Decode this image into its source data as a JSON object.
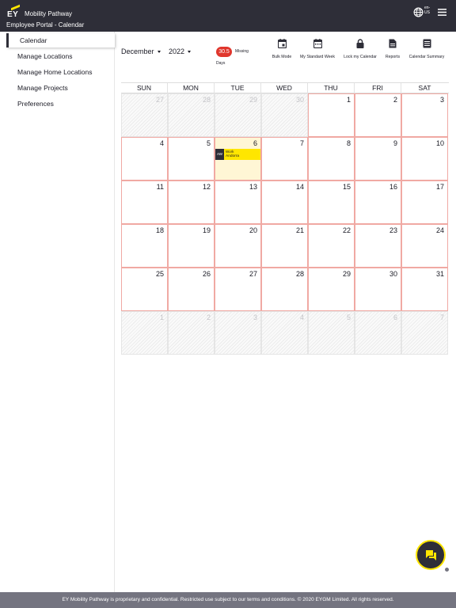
{
  "header": {
    "logo_text": "EY",
    "app_title": "Mobility Pathway",
    "subtitle": "Employee Portal - Calendar",
    "language": "en-US"
  },
  "sidebar": {
    "items": [
      {
        "label": "Calendar",
        "active": true
      },
      {
        "label": "Manage Locations"
      },
      {
        "label": "Manage Home Locations"
      },
      {
        "label": "Manage Projects"
      },
      {
        "label": "Preferences"
      }
    ]
  },
  "toolbar": {
    "month": "December",
    "year": "2022",
    "missing_count": "30.5",
    "missing_label": "Missing",
    "missing_days_label": "Days",
    "tools": [
      {
        "label": "Bulk Mode",
        "icon": "calendar-event-icon"
      },
      {
        "label": "My Standard Week",
        "icon": "calendar-week-icon"
      },
      {
        "label": "Lock my Calendar",
        "icon": "lock-icon"
      },
      {
        "label": "Reports",
        "icon": "document-icon"
      },
      {
        "label": "Calendar Summary",
        "icon": "list-icon"
      }
    ]
  },
  "calendar": {
    "weekdays": [
      "SUN",
      "MON",
      "TUE",
      "WED",
      "THU",
      "FRI",
      "SAT"
    ],
    "weeks": [
      [
        {
          "d": "27",
          "o": true
        },
        {
          "d": "28",
          "o": true
        },
        {
          "d": "29",
          "o": true
        },
        {
          "d": "30",
          "o": true
        },
        {
          "d": "1"
        },
        {
          "d": "2"
        },
        {
          "d": "3"
        }
      ],
      [
        {
          "d": "4"
        },
        {
          "d": "5"
        },
        {
          "d": "6",
          "today": true
        },
        {
          "d": "7"
        },
        {
          "d": "8"
        },
        {
          "d": "9"
        },
        {
          "d": "10"
        }
      ],
      [
        {
          "d": "11"
        },
        {
          "d": "12"
        },
        {
          "d": "13"
        },
        {
          "d": "14"
        },
        {
          "d": "15"
        },
        {
          "d": "16"
        },
        {
          "d": "17"
        }
      ],
      [
        {
          "d": "18"
        },
        {
          "d": "19"
        },
        {
          "d": "20"
        },
        {
          "d": "21"
        },
        {
          "d": "22"
        },
        {
          "d": "23"
        },
        {
          "d": "24"
        }
      ],
      [
        {
          "d": "25"
        },
        {
          "d": "26"
        },
        {
          "d": "27"
        },
        {
          "d": "28"
        },
        {
          "d": "29"
        },
        {
          "d": "30"
        },
        {
          "d": "31"
        }
      ],
      [
        {
          "d": "1",
          "o": true
        },
        {
          "d": "2",
          "o": true
        },
        {
          "d": "3",
          "o": true
        },
        {
          "d": "4",
          "o": true
        },
        {
          "d": "5",
          "o": true
        },
        {
          "d": "6",
          "o": true
        },
        {
          "d": "7",
          "o": true
        }
      ]
    ],
    "event": {
      "code": "AW",
      "type": "Work",
      "location": "Andorra"
    }
  },
  "colors": {
    "header_bg": "#2e2e38",
    "brand_yellow": "#ffe600",
    "missing_red": "#e0362c",
    "footer_bg": "#747480"
  },
  "chat_icon": "chat-icon",
  "footer": {
    "text": "EY Mobility Pathway is proprietary and confidential. Restricted use subject to our terms and conditions. © 2020 EYGM Limited. All rights reserved."
  }
}
